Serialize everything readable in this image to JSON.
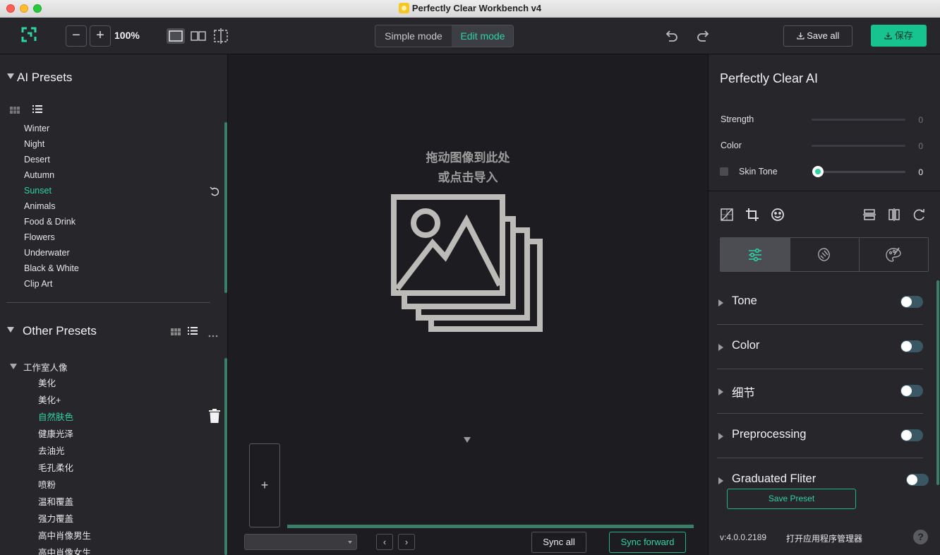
{
  "window": {
    "title": "Perfectly Clear Workbench v4"
  },
  "toolbar": {
    "zoom_out_label": "−",
    "zoom_in_label": "+",
    "zoom_level": "100%",
    "mode_simple": "Simple mode",
    "mode_edit": "Edit mode",
    "save_all_label": "Save all",
    "save_label": "保存"
  },
  "left": {
    "ai_presets_title": "AI Presets",
    "ai_presets": [
      "Winter",
      "Night",
      "Desert",
      "Autumn",
      "Sunset",
      "Animals",
      "Food & Drink",
      "Flowers",
      "Underwater",
      "Black & White",
      "Clip Art"
    ],
    "ai_active": "Sunset",
    "other_presets_title": "Other Presets",
    "group_name": "工作室人像",
    "group_items": [
      "美化",
      "美化+",
      "自然肤色",
      "健康光泽",
      "去油光",
      "毛孔柔化",
      "喷粉",
      "温和覆盖",
      "强力覆盖",
      "高中肖像男生",
      "高中肖像女生"
    ],
    "group_active": "自然肤色"
  },
  "center": {
    "drop_line1": "拖动图像到此处",
    "drop_line2": "或点击导入",
    "add_label": "+",
    "prev_label": "‹",
    "next_label": "›",
    "sync_all": "Sync all",
    "sync_forward": "Sync forward"
  },
  "right": {
    "title": "Perfectly Clear AI",
    "strength_label": "Strength",
    "strength_value": "0",
    "color_label": "Color",
    "color_value": "0",
    "skin_tone_label": "Skin Tone",
    "skin_tone_value": "0",
    "sections": [
      "Tone",
      "Color",
      "细节",
      "Preprocessing",
      "Graduated Fliter"
    ],
    "save_preset": "Save Preset",
    "version": "v:4.0.0.2189",
    "app_manager": "打开应用程序管理器",
    "help": "?"
  },
  "colors": {
    "accent": "#2ed3a5",
    "save_button": "#17c38e",
    "panel_bg": "#26262b",
    "canvas_bg": "#1d1d21"
  },
  "icons": [
    "logo-icon",
    "single-view-icon",
    "split-view-icon",
    "crop-view-icon",
    "undo-icon",
    "redo-icon",
    "download-icon",
    "grid-view-icon",
    "list-view-icon",
    "more-icon",
    "reset-icon",
    "trash-icon",
    "image-stack-icon",
    "curves-icon",
    "crop-icon",
    "face-icon",
    "flip-vertical-icon",
    "flip-horizontal-icon",
    "rotate-icon",
    "sliders-icon",
    "lasso-icon",
    "palette-icon",
    "help-icon"
  ]
}
